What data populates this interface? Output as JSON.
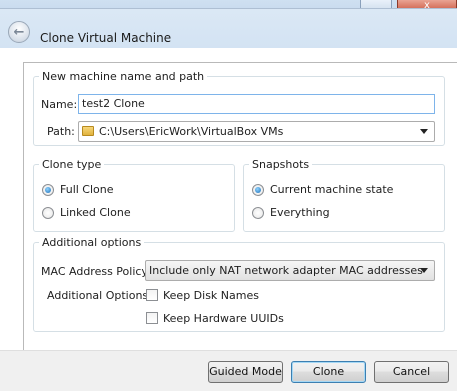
{
  "window": {
    "minimize_glyph": "_",
    "close_glyph": "x"
  },
  "header": {
    "back_glyph": "←",
    "title": "Clone Virtual Machine"
  },
  "machine_group": {
    "legend": "New machine name and path",
    "name_label": "Name:",
    "name_value": "test2 Clone",
    "path_label": "Path:",
    "path_value": "C:\\Users\\EricWork\\VirtualBox VMs"
  },
  "clone_type": {
    "legend": "Clone type",
    "options": [
      {
        "label": "Full Clone",
        "checked": true
      },
      {
        "label": "Linked Clone",
        "checked": false
      }
    ]
  },
  "snapshots": {
    "legend": "Snapshots",
    "options": [
      {
        "label": "Current machine state",
        "checked": true
      },
      {
        "label": "Everything",
        "checked": false
      }
    ]
  },
  "additional": {
    "legend": "Additional options",
    "mac_label": "MAC Address Policy:",
    "mac_value": "Include only NAT network adapter MAC addresses",
    "options_label": "Additional Options:",
    "keep_disk_names": {
      "label": "Keep Disk Names",
      "checked": false
    },
    "keep_hw_uuids": {
      "label": "Keep Hardware UUIDs",
      "checked": false
    }
  },
  "footer": {
    "guided_mode": "Guided Mode",
    "clone": "Clone",
    "cancel": "Cancel"
  }
}
